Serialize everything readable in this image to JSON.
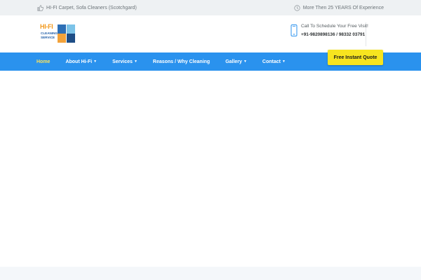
{
  "topbar": {
    "left_icon": "thumbs-up-icon",
    "left_text": "HI-FI Carpet, Sofa Cleaners (Scotchgard)",
    "right_icon": "clock-icon",
    "right_text": "More Then 25 YEARS Of Experience"
  },
  "logo": {
    "line1": "HI-FI",
    "line2": "CLEANING",
    "line3": "SERVICE"
  },
  "contact": {
    "icon": "mobile-phone-icon",
    "line1": "Call To Schedule Your Free Visit!",
    "line2": "+91-9820898136 / 98332 03791"
  },
  "nav": {
    "items": [
      {
        "label": "Home",
        "active": true,
        "dropdown": false
      },
      {
        "label": "About Hi-Fi",
        "active": false,
        "dropdown": true
      },
      {
        "label": "Services",
        "active": false,
        "dropdown": true
      },
      {
        "label": "Reasons / Why Cleaning",
        "active": false,
        "dropdown": false
      },
      {
        "label": "Gallery",
        "active": false,
        "dropdown": true
      },
      {
        "label": "Contact",
        "active": false,
        "dropdown": true
      }
    ],
    "caret_glyph": "▼"
  },
  "cta": {
    "label": "Free Instant Quote"
  },
  "colors": {
    "topbar_bg": "#eef1f3",
    "nav_bg": "#2a92ee",
    "nav_active": "#ffe45a",
    "cta_bg": "#f7e41f",
    "logo_orange": "#f29a1f",
    "logo_blue": "#1f5da8"
  }
}
